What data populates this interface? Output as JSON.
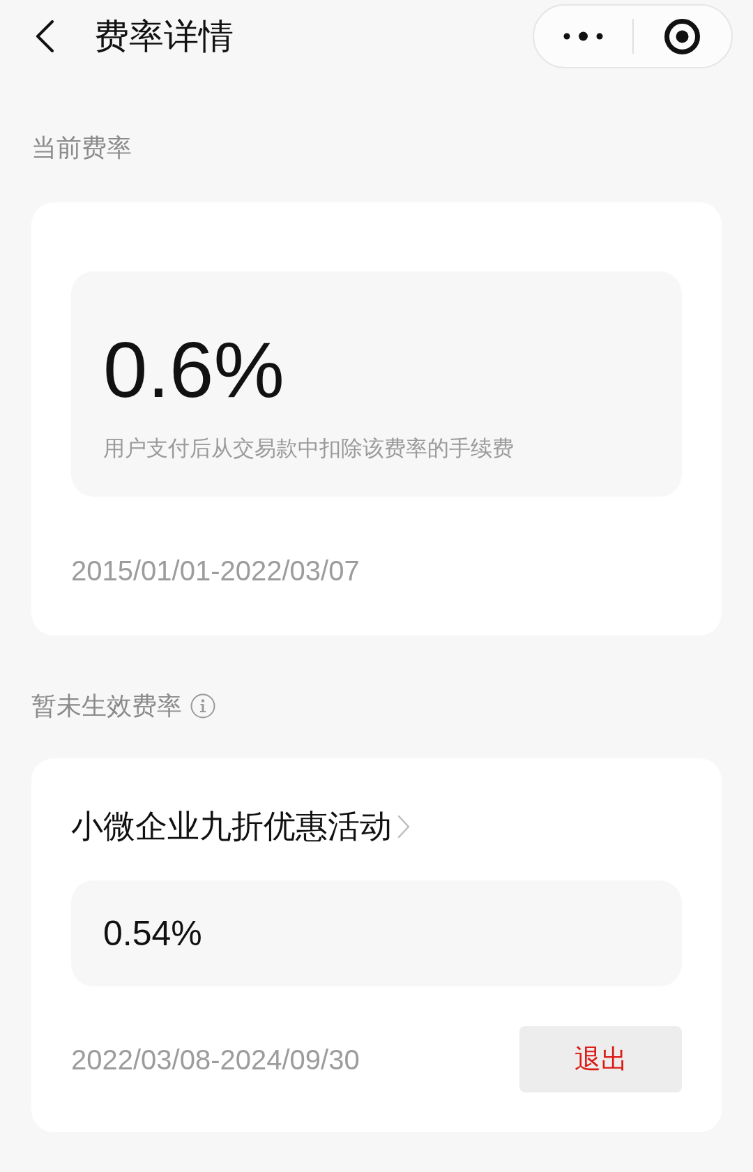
{
  "nav": {
    "title": "费率详情"
  },
  "current": {
    "heading": "当前费率",
    "rate": "0.6%",
    "description": "用户支付后从交易款中扣除该费率的手续费",
    "period": "2015/01/01-2022/03/07"
  },
  "pending": {
    "heading": "暂未生效费率",
    "items": [
      {
        "name": "小微企业九折优惠活动",
        "rate": "0.54%",
        "period": "2022/03/08-2024/09/30",
        "action": "退出"
      }
    ]
  }
}
